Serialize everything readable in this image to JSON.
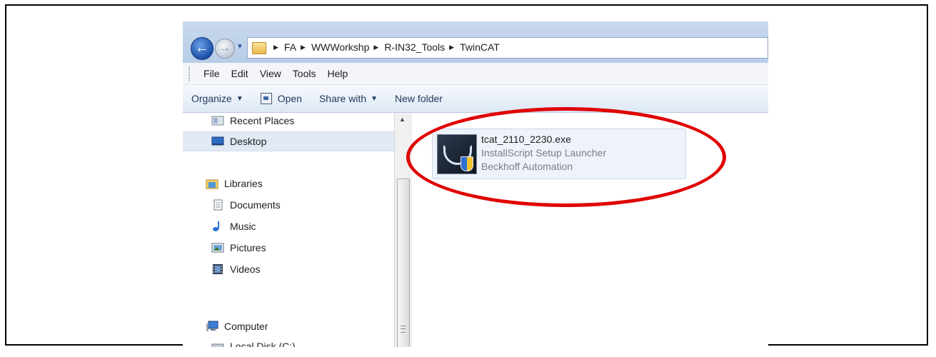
{
  "address": {
    "crumbs": [
      "FA",
      "WWWorkshp",
      "R-IN32_Tools",
      "TwinCAT"
    ]
  },
  "menu": [
    "File",
    "Edit",
    "View",
    "Tools",
    "Help"
  ],
  "commands": {
    "organize": "Organize",
    "open": "Open",
    "share_with": "Share with",
    "new_folder": "New folder"
  },
  "nav": {
    "recent_places": "Recent Places",
    "desktop": "Desktop",
    "libraries": "Libraries",
    "documents": "Documents",
    "music": "Music",
    "pictures": "Pictures",
    "videos": "Videos",
    "computer": "Computer",
    "local_disk": "Local Disk (C:)"
  },
  "file": {
    "name": "tcat_2110_2230.exe",
    "description": "InstallScript Setup Launcher",
    "company": "Beckhoff Automation"
  },
  "colors": {
    "highlight": "#e00000",
    "selection": "#e1e9f4"
  }
}
